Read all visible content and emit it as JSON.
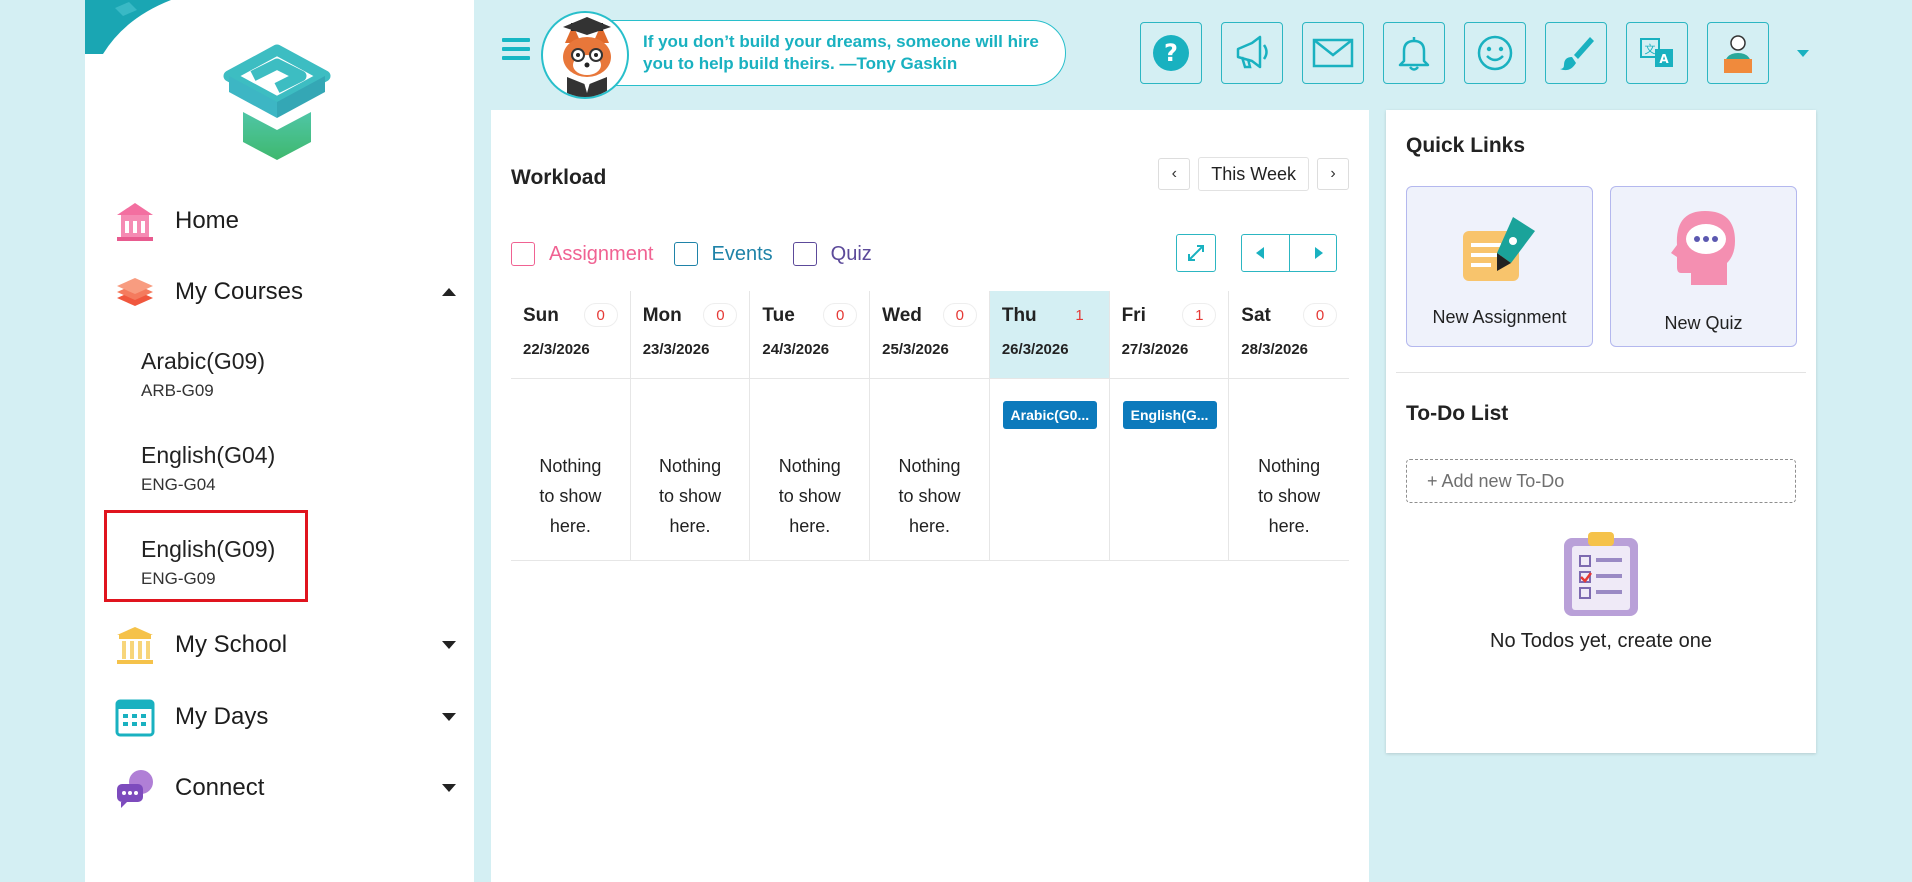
{
  "quote": {
    "text": "If you don’t build your dreams, someone will hire you to help build theirs. —Tony Gaskin"
  },
  "toolbar": {
    "buttons": [
      {
        "name": "help",
        "icon": "question-icon"
      },
      {
        "name": "announcements",
        "icon": "megaphone-icon"
      },
      {
        "name": "messages",
        "icon": "mail-icon"
      },
      {
        "name": "notifications",
        "icon": "bell-icon"
      },
      {
        "name": "feedback",
        "icon": "smiley-icon"
      },
      {
        "name": "theme",
        "icon": "brush-icon"
      },
      {
        "name": "language",
        "icon": "translate-icon"
      },
      {
        "name": "profile",
        "icon": "avatar-icon"
      }
    ]
  },
  "sidebar": {
    "home": "Home",
    "my_courses": "My Courses",
    "courses": [
      {
        "name": "Arabic(G09)",
        "code": "ARB-G09"
      },
      {
        "name": "English(G04)",
        "code": "ENG-G04"
      },
      {
        "name": "English(G09)",
        "code": "ENG-G09"
      }
    ],
    "my_school": "My School",
    "my_days": "My Days",
    "connect": "Connect"
  },
  "workload": {
    "title": "Workload",
    "week_label": "This Week",
    "prev_symbol": "‹",
    "next_symbol": "›",
    "filters": [
      {
        "label": "Assignment",
        "color": "#f06292"
      },
      {
        "label": "Events",
        "color": "#1f83a8"
      },
      {
        "label": "Quiz",
        "color": "#5c4a9a"
      }
    ],
    "empty_text": "Nothing to show here.",
    "days": [
      {
        "name": "Sun",
        "count": "0",
        "date": "22/3/2026",
        "event": ""
      },
      {
        "name": "Mon",
        "count": "0",
        "date": "23/3/2026",
        "event": ""
      },
      {
        "name": "Tue",
        "count": "0",
        "date": "24/3/2026",
        "event": ""
      },
      {
        "name": "Wed",
        "count": "0",
        "date": "25/3/2026",
        "event": ""
      },
      {
        "name": "Thu",
        "count": "1",
        "date": "26/3/2026",
        "event": "Arabic(G0..."
      },
      {
        "name": "Fri",
        "count": "1",
        "date": "27/3/2026",
        "event": "English(G..."
      },
      {
        "name": "Sat",
        "count": "0",
        "date": "28/3/2026",
        "event": ""
      }
    ]
  },
  "quick_links": {
    "title": "Quick Links",
    "new_assignment": "New Assignment",
    "new_quiz": "New Quiz"
  },
  "todo": {
    "title": "To-Do List",
    "placeholder": "+ Add new To-Do",
    "empty": "No Todos yet, create one"
  },
  "colors": {
    "accent": "#19b1c0",
    "background": "#d4eff3",
    "event_blue": "#0c7abc",
    "highlight_red": "#e0141e"
  }
}
